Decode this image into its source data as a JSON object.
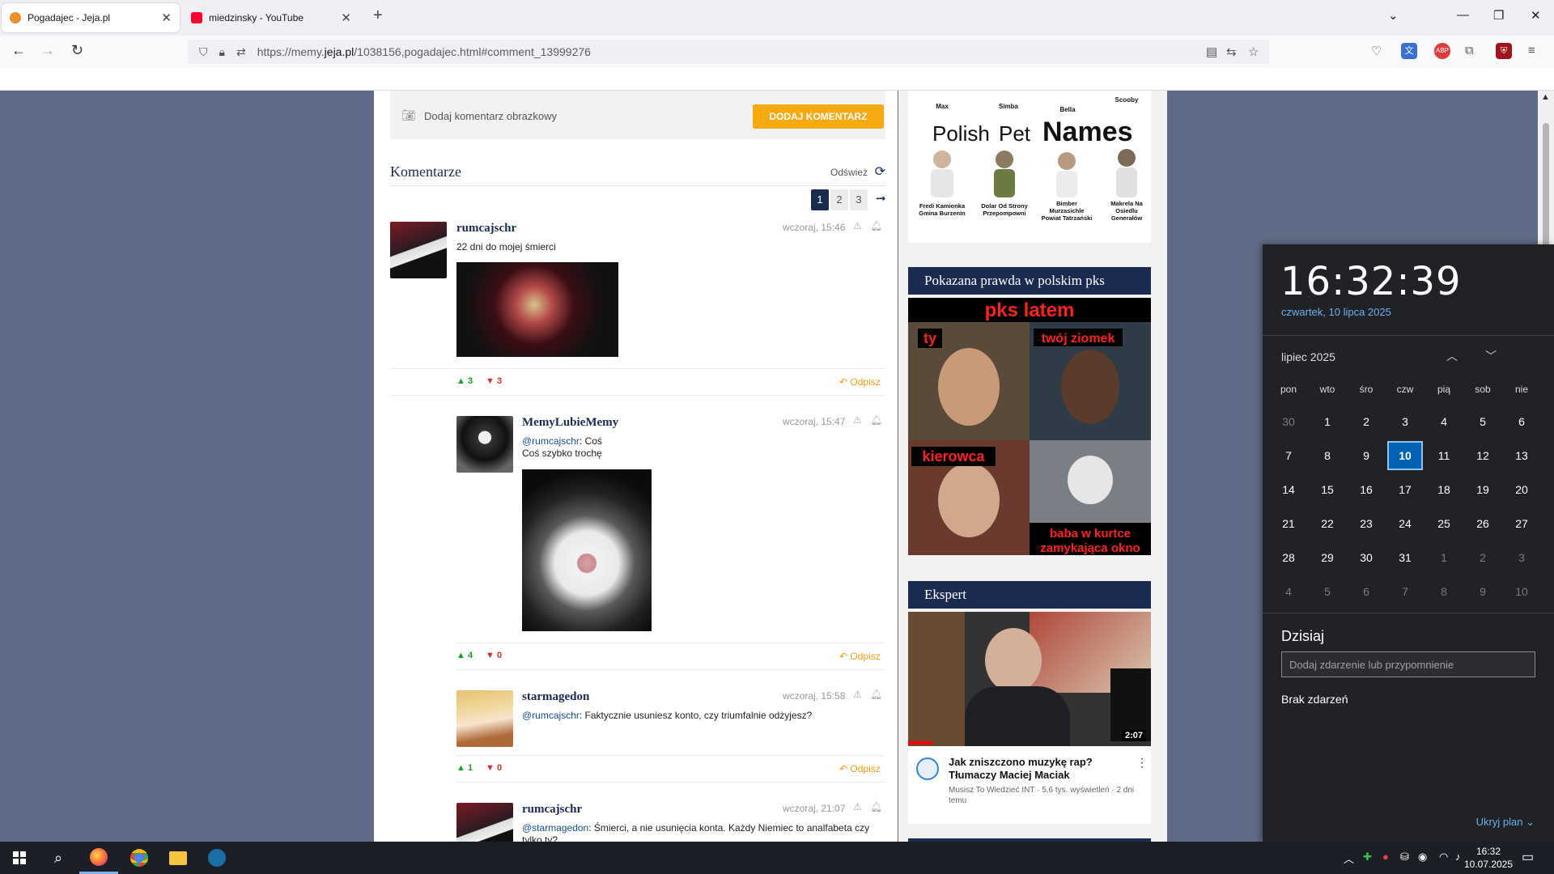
{
  "browser": {
    "tabs": [
      {
        "title": "Pogadajec - Jeja.pl",
        "active": true
      },
      {
        "title": "miedzinsky - YouTube",
        "active": false
      }
    ],
    "url_pre": "https://memy.",
    "url_domain": "jeja.pl",
    "url_post": "/1038156,pogadajec.html#comment_13999276",
    "ext_abp": "ABP"
  },
  "page": {
    "add_image_label": "Dodaj komentarz obrazkowy",
    "add_button": "DODAJ KOMENTARZ",
    "comments_title": "Komentarze",
    "refresh_label": "Odśwież",
    "pages": [
      "1",
      "2",
      "3"
    ],
    "reply_label": "Odpisz",
    "comments": [
      {
        "user": "rumcajschr",
        "time": "wczoraj, 15:46",
        "text": "22 dni do mojej śmierci",
        "up": "3",
        "down": "3"
      },
      {
        "user": "MemyLubieMemy",
        "time": "wczoraj, 15:47",
        "mention": "@rumcajschr",
        "text_after": ": Coś",
        "text2": "Coś szybko trochę",
        "up": "4",
        "down": "0"
      },
      {
        "user": "starmagedon",
        "time": "wczoraj, 15:58",
        "mention": "@rumcajschr",
        "text_after": ": Faktycznie usuniesz konto, czy triumfalnie odżyjesz?",
        "up": "1",
        "down": "0"
      },
      {
        "user": "rumcajschr",
        "time": "wczoraj, 21:07",
        "mention": "@starmagedon",
        "text_after": ": Śmierci, a nie usunięcia konta. Każdy Niemiec to analfabeta czy",
        "text2": "tylko ty?"
      }
    ]
  },
  "sidebar": {
    "pets_top": [
      "Max",
      "Simba",
      "Bella",
      "Scooby"
    ],
    "pets_title_a": "Polish",
    "pets_title_b": "Pet",
    "pets_title_c": "Names",
    "pets": [
      "Fredi Kamionka Gmina Burzenin",
      "Dolar Od Strony Przepompowni",
      "Bimber Murzasichle Powiat Tatrzański",
      "Makrela Na Osiedlu Generałów"
    ],
    "card2_title": "Pokazana prawda w polskim pks",
    "meme_top": "pks latem",
    "meme_labels": [
      "ty",
      "twój ziomek",
      "kierowca",
      "baba w kurtce zamykająca okno"
    ],
    "card3_title": "Ekspert",
    "video_duration": "2:07",
    "video_title": "Jak zniszczono muzykę rap? Tłumaczy Maciej Maciak",
    "video_meta": "Musisz To Wiedzieć INT · 5,6 tys. wyświetleń · 2 dni temu"
  },
  "calendar": {
    "time": "16:32:39",
    "date": "czwartek, 10 lipca 2025",
    "month": "lipiec 2025",
    "weekdays": [
      "pon",
      "wto",
      "śro",
      "czw",
      "pią",
      "sob",
      "nie"
    ],
    "days": [
      [
        "30",
        "1",
        "2",
        "3",
        "4",
        "5",
        "6"
      ],
      [
        "7",
        "8",
        "9",
        "10",
        "11",
        "12",
        "13"
      ],
      [
        "14",
        "15",
        "16",
        "17",
        "18",
        "19",
        "20"
      ],
      [
        "21",
        "22",
        "23",
        "24",
        "25",
        "26",
        "27"
      ],
      [
        "28",
        "29",
        "30",
        "31",
        "1",
        "2",
        "3"
      ],
      [
        "4",
        "5",
        "6",
        "7",
        "8",
        "9",
        "10"
      ]
    ],
    "today_label": "Dzisiaj",
    "event_placeholder": "Dodaj zdarzenie lub przypomnienie",
    "no_events": "Brak zdarzeń",
    "hide_plan": "Ukryj plan"
  },
  "taskbar": {
    "time": "16:32",
    "date": "10.07.2025"
  },
  "colors": {
    "navy": "#1b2b4f",
    "orange": "#f7a90f",
    "vote_up": "#1d9b2a",
    "vote_down": "#d52b2b",
    "calendar_accent": "#0063b1"
  }
}
